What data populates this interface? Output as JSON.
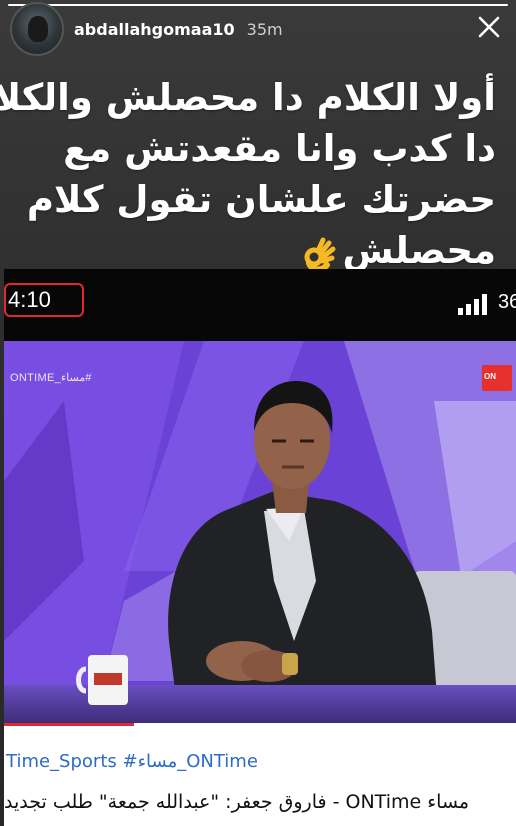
{
  "story": {
    "username": "abdallahgomaa10",
    "time_ago": "35m",
    "progress_fraction": 1.0,
    "caption_lines": [
      "أولا الكلام دا محصلش والكلام",
      "دا كدب وانا مقعدتش مع",
      "حضرتك علشان تقول كلام",
      "محصلش"
    ],
    "caption_emoji": "ok-hand-icon"
  },
  "embedded": {
    "clock": "4:10",
    "signal_text": "36",
    "video_watermark": "ONTIME_مساء#",
    "channel_logo": "ON",
    "hashtags": "Time_Sports #مساء_ONTime",
    "news_title": "مساء ONTime - فاروق جعفر: \"عبدالله جمعة\" طلب تجديد"
  },
  "colors": {
    "accent_red": "#e0282d",
    "studio_purple": "#6b3fcf",
    "hashtag_blue": "#2d6bc7"
  }
}
